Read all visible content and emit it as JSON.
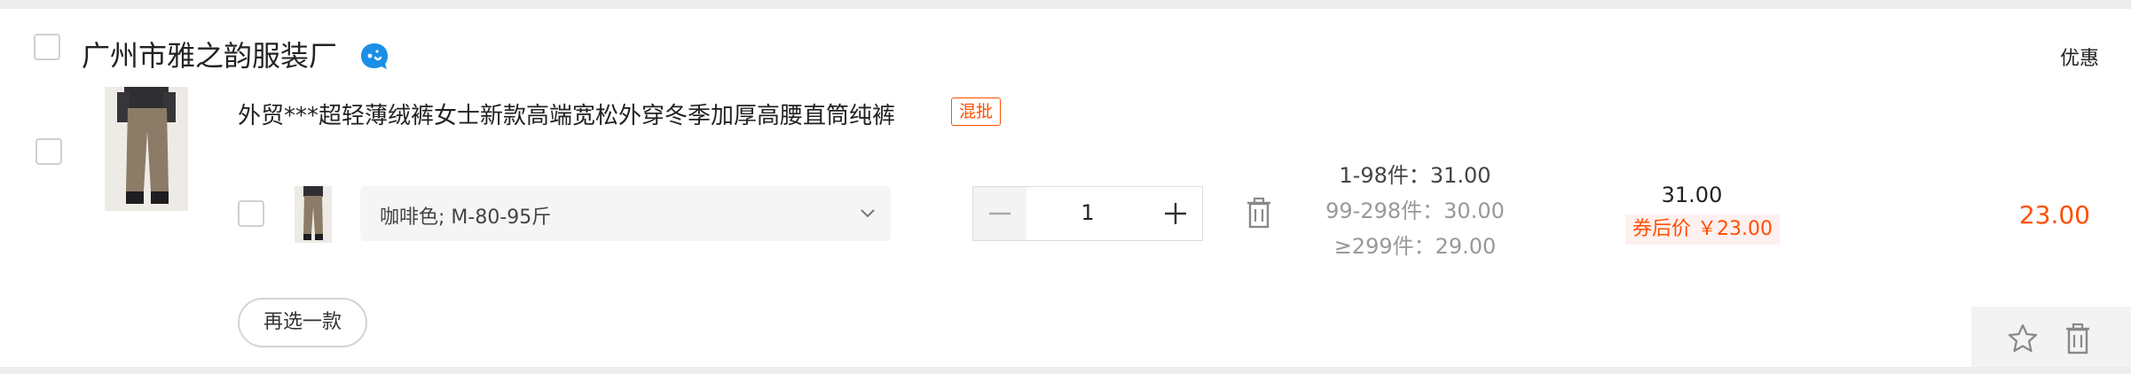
{
  "shop": {
    "name": "广州市雅之韵服装厂",
    "discount_label": "优惠"
  },
  "product": {
    "title": "外贸***超轻薄绒裤女士新款高端宽松外穿冬季加厚高腰直筒纯裤",
    "tag": "混批",
    "sku": "咖啡色; M-80-95斤",
    "quantity": "1",
    "price_tiers": [
      "1-98件：31.00",
      "99-298件：30.00",
      "≥299件：29.00"
    ],
    "unit_price": "31.00",
    "coupon_price": "券后价 ￥23.00",
    "subtotal": "23.00",
    "reselect_label": "再选一款"
  },
  "colors": {
    "accent": "#ff4f00",
    "wangwang": "#1a8fe6"
  },
  "icons": {
    "wangwang": "wangwang-chat-icon",
    "trash": "trash-icon",
    "star": "star-icon",
    "chevron": "chevron-down-icon",
    "minus": "minus-icon",
    "plus": "plus-icon"
  }
}
